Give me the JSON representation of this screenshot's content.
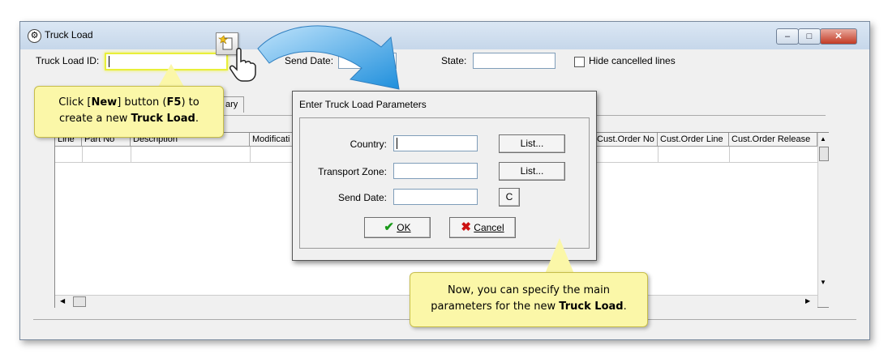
{
  "window": {
    "title": "Truck Load",
    "icon": "gear-icon",
    "controls": {
      "minimize": "–",
      "maximize": "□",
      "close": "✕"
    }
  },
  "form": {
    "truck_load_id_label": "Truck Load ID:",
    "truck_load_id_value": "",
    "send_date_label": "Send Date:",
    "state_label": "State:",
    "state_value": "",
    "hide_cancelled_label": "Hide cancelled lines"
  },
  "tab_fragment": "ary",
  "grid": {
    "columns": [
      "Line",
      "Part No",
      "Description",
      "Modificati",
      "Cust.Order No",
      "Cust.Order Line",
      "Cust.Order Release"
    ]
  },
  "dialog": {
    "title": "Enter Truck Load Parameters",
    "country_label": "Country:",
    "transport_zone_label": "Transport Zone:",
    "send_date_label": "Send Date:",
    "list_button": "List...",
    "clear_button": "C",
    "ok_button": "OK",
    "cancel_button": "Cancel"
  },
  "callout_new": {
    "line1_a": "Click [",
    "line1_b": "New",
    "line1_c": "] button (",
    "line1_d": "F5",
    "line1_e": ") to",
    "line2_a": "create a new ",
    "line2_b": "Truck Load",
    "line2_c": "."
  },
  "callout_params": {
    "line1": "Now, you can specify the main",
    "line2_a": "parameters for the new ",
    "line2_b": "Truck Load",
    "line2_c": "."
  },
  "colors": {
    "callout": "#fbf7a8",
    "arrow": "#2f9fe0",
    "ok_check": "#1a9a1a",
    "cancel_x": "#cc1111"
  }
}
